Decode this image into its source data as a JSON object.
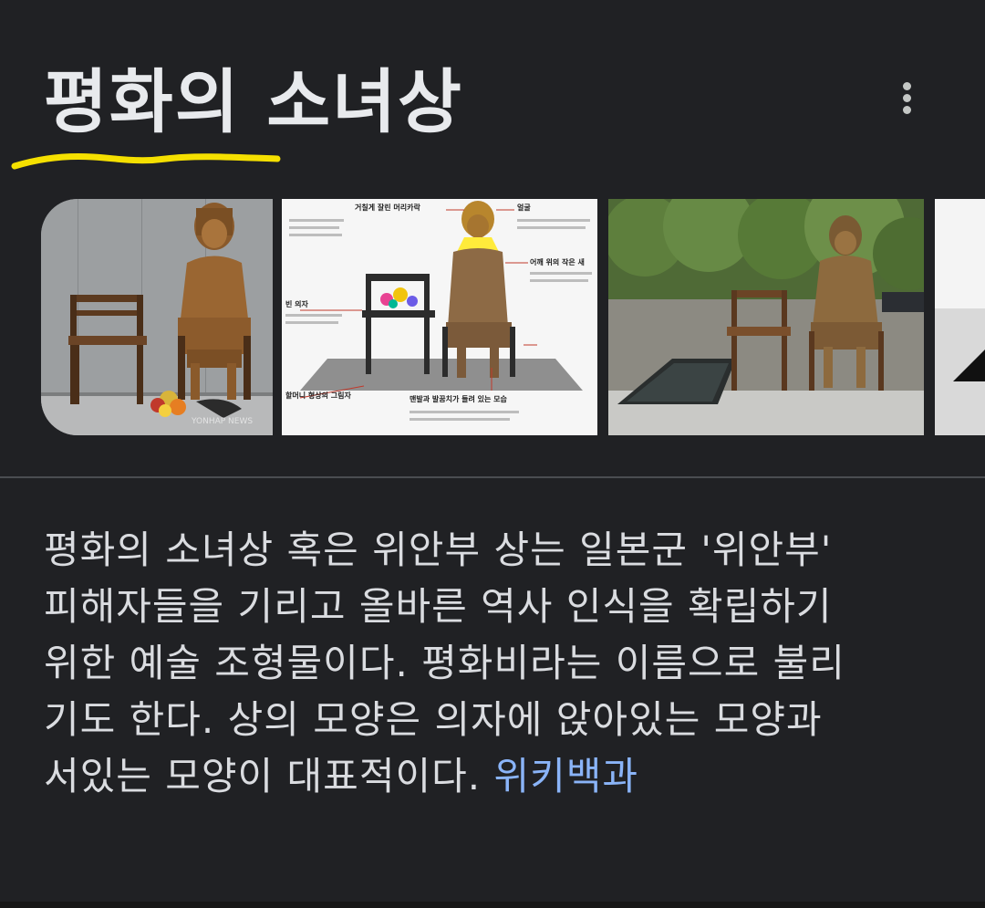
{
  "title": "평화의 소녀상",
  "menu_icon": "more-vert-icon",
  "images": [
    {
      "label": "statue-photo-with-flowers",
      "watermark": "YONHAP NEWS"
    },
    {
      "label": "statue-annotated-diagram",
      "annotations": [
        "거칠게 잘린 머리카락",
        "얼굴",
        "어깨 위의 작은 새",
        "빈 의자",
        "맨발과 발꿈치가 들려 있는 모습",
        "할머니 형상의 그림자",
        "빈 의자"
      ]
    },
    {
      "label": "statue-in-park-photo"
    },
    {
      "label": "statue-indoor-photo"
    }
  ],
  "description": {
    "lines": [
      "평화의 소녀상 혹은 위안부 상는 일본군 '위안부'",
      "피해자들을 기리고 올바른 역사 인식을 확립하기",
      "위한 예술 조형물이다. 평화비라는 이름으로 불리",
      "기도 한다. 상의 모양은 의자에 앉아있는 모양과",
      "서있는 모양이 대표적이다."
    ],
    "source_link": "위키백과"
  },
  "colors": {
    "background": "#202124",
    "text": "#e8eaed",
    "link": "#8ab4f8",
    "highlight": "#f5e000"
  }
}
